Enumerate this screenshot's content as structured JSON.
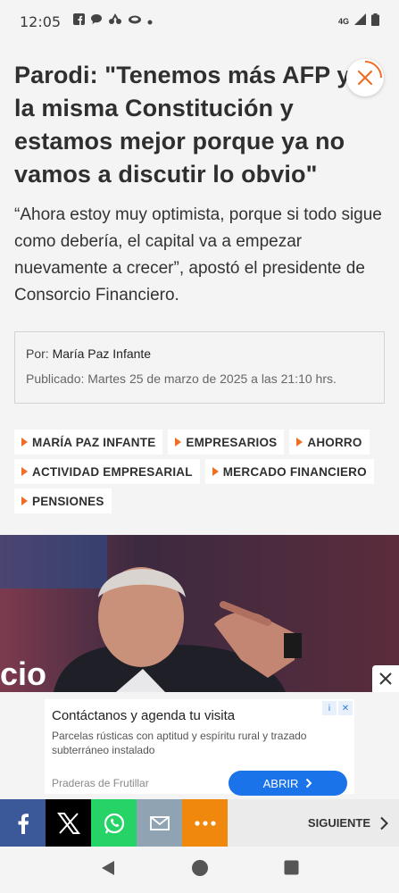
{
  "status_bar": {
    "time": "12:05",
    "network": "4G"
  },
  "article": {
    "headline": "Parodi: \"Tenemos más AFP y la misma Constitución y estamos mejor porque ya no vamos a discutir lo obvio\"",
    "subtitle": "“Ahora estoy muy optimista, porque si todo sigue como debería, el capital va a empezar nuevamente a crecer”, apostó el presidente de Consorcio Financiero.",
    "author_prefix": "Por:",
    "author": "María Paz Infante",
    "published": "Publicado: Martes 25 de marzo de 2025 a las 21:10 hrs.",
    "tags": [
      "MARÍA PAZ INFANTE",
      "EMPRESARIOS",
      "AHORRO",
      "ACTIVIDAD EMPRESARIAL",
      "MERCADO FINANCIERO",
      "PENSIONES"
    ]
  },
  "ad": {
    "title": "Contáctanos y agenda tu visita",
    "description": "Parcelas rústicas con aptitud y espíritu rural y trazado subterráneo instalado",
    "advertiser": "Praderas de Frutillar",
    "cta": "ABRIR"
  },
  "share_bar": {
    "next_label": "SIGUIENTE"
  },
  "colors": {
    "accent": "#f06e23",
    "facebook": "#3b5998",
    "x": "#000000",
    "whatsapp": "#25d366",
    "email": "#8fa3b2",
    "more": "#f0880e",
    "ad_button": "#1a73e8"
  }
}
